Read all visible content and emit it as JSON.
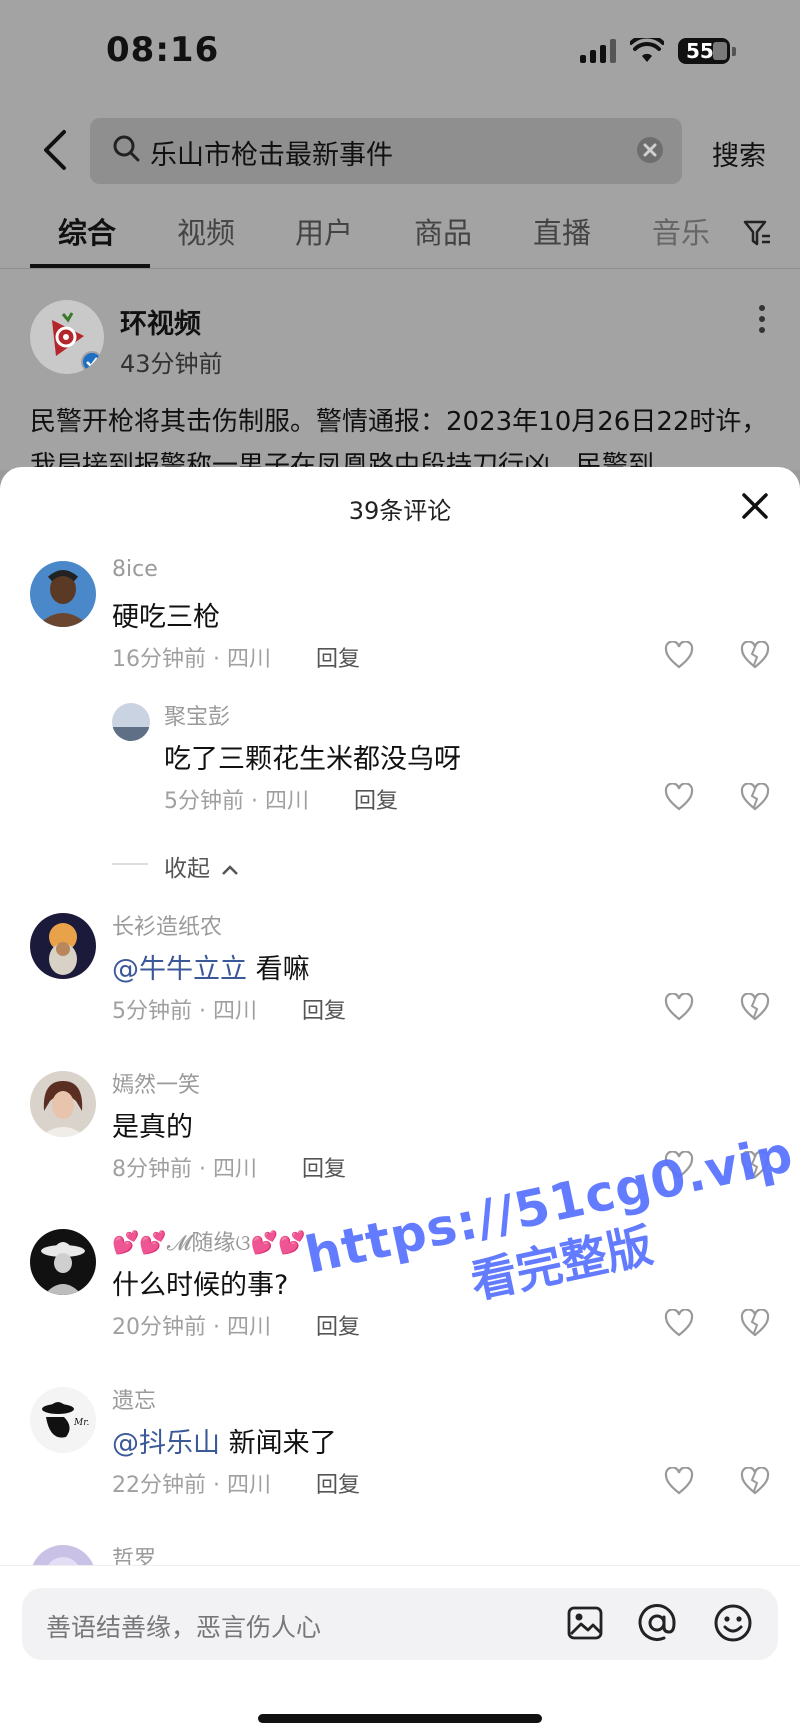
{
  "status_bar": {
    "time": "08:16",
    "battery": "55",
    "icons": [
      "signal-icon",
      "wifi-icon",
      "battery-icon"
    ]
  },
  "search": {
    "query": "乐山市枪击最新事件",
    "button": "搜索"
  },
  "tabs": [
    "综合",
    "视频",
    "用户",
    "商品",
    "直播",
    "音乐"
  ],
  "post": {
    "author": "环视频",
    "time": "43分钟前",
    "text": "民警开枪将其击伤制服。警情通报：2023年10月26日22时许，我局接到报警称一男子在凤凰路中段持刀行凶，民警到"
  },
  "comments_sheet": {
    "title": "39条评论",
    "collapse": "收起",
    "comments": [
      {
        "user": "8ice",
        "text": "硬吃三枪",
        "meta": "16分钟前 · 四川",
        "reply": "回复"
      },
      {
        "user": "聚宝彭",
        "text": "吃了三颗花生米都没乌呀",
        "meta": "5分钟前 · 四川",
        "reply": "回复"
      },
      {
        "user": "长衫造纸农",
        "mention": "@牛牛立立",
        "text": "看嘛",
        "meta": "5分钟前 · 四川",
        "reply": "回复"
      },
      {
        "user": "嫣然一笑",
        "text": "是真的",
        "meta": "8分钟前 · 四川",
        "reply": "回复"
      },
      {
        "user": "💕💕𝓜随缘ଓ💕💕",
        "text": "什么时候的事?",
        "meta": "20分钟前 · 四川",
        "reply": "回复"
      },
      {
        "user": "遗忘",
        "mention": "@抖乐山",
        "text": "新闻来了",
        "meta": "22分钟前 · 四川",
        "reply": "回复"
      },
      {
        "user": "哲罗"
      }
    ]
  },
  "watermark": {
    "line1": "https://51cg0.vip",
    "line2": "看完整版"
  },
  "input": {
    "placeholder": "善语结善缘，恶言伤人心"
  }
}
